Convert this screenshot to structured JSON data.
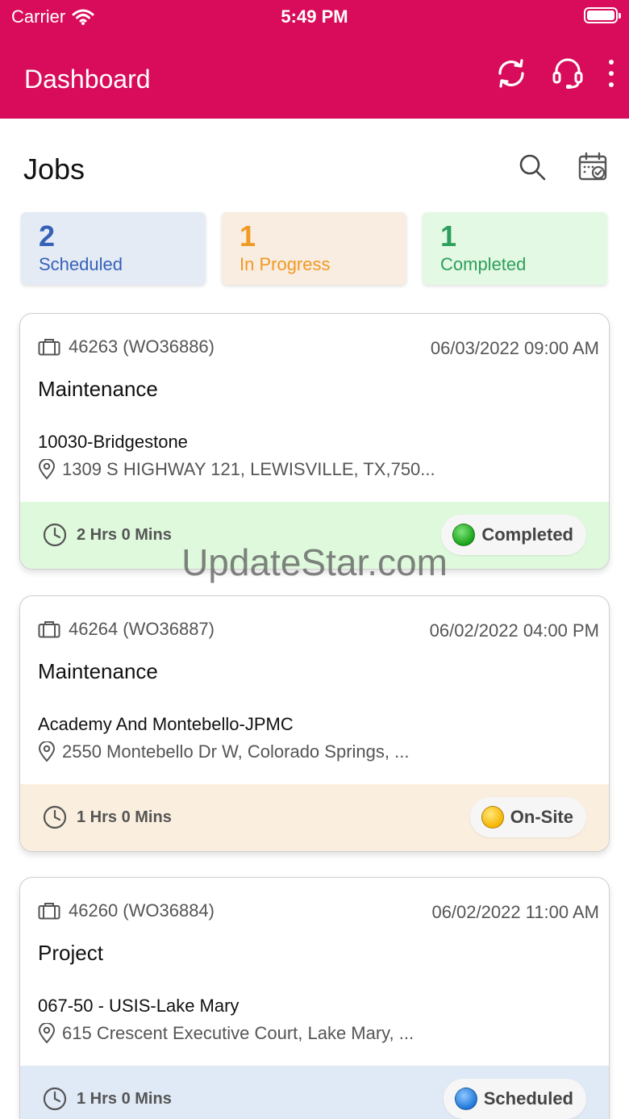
{
  "status_bar": {
    "carrier": "Carrier",
    "time": "5:49 PM"
  },
  "nav": {
    "title": "Dashboard"
  },
  "jobs": {
    "title": "Jobs"
  },
  "summary": [
    {
      "count": "2",
      "label": "Scheduled"
    },
    {
      "count": "1",
      "label": "In Progress"
    },
    {
      "count": "1",
      "label": "Completed"
    }
  ],
  "cards": [
    {
      "id": "46263 (WO36886)",
      "date": "06/03/2022 09:00 AM",
      "type": "Maintenance",
      "site": "10030-Bridgestone",
      "address": "1309 S HIGHWAY 121, LEWISVILLE, TX,750...",
      "duration": "2 Hrs 0 Mins",
      "status": "Completed"
    },
    {
      "id": "46264 (WO36887)",
      "date": "06/02/2022 04:00 PM",
      "type": "Maintenance",
      "site": "Academy And Montebello-JPMC",
      "address": "2550 Montebello Dr W, Colorado Springs, ...",
      "duration": "1 Hrs 0 Mins",
      "status": "On-Site"
    },
    {
      "id": "46260 (WO36884)",
      "date": "06/02/2022 11:00 AM",
      "type": "Project",
      "site": "067-50 - USIS-Lake Mary",
      "address": "615 Crescent Executive Court, Lake Mary, ...",
      "duration": "1 Hrs 0 Mins",
      "status": "Scheduled"
    }
  ],
  "watermark": "UpdateStar.com",
  "colors": {
    "header": "#d80c5a",
    "scheduled": "#3661b8",
    "in_progress": "#f09a24",
    "completed": "#2e9e5c"
  },
  "icons": [
    "wifi-icon",
    "battery-icon",
    "sync-icon",
    "headset-icon",
    "more-vertical-icon",
    "search-icon",
    "calendar-check-icon",
    "briefcase-icon",
    "location-pin-icon",
    "clock-icon"
  ]
}
